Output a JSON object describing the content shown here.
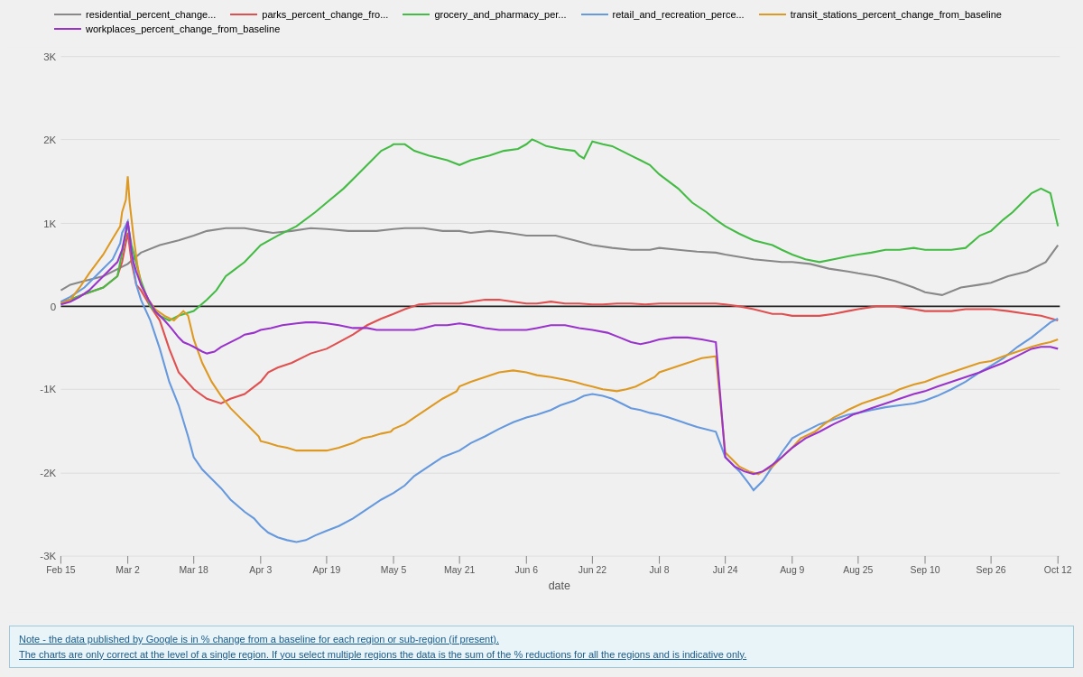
{
  "legend": {
    "items": [
      {
        "label": "residential_percent_change...",
        "color": "#888888"
      },
      {
        "label": "parks_percent_change_fro...",
        "color": "#e05050"
      },
      {
        "label": "grocery_and_pharmacy_per...",
        "color": "#44bb44"
      },
      {
        "label": "retail_and_recreation_perce...",
        "color": "#6699dd"
      },
      {
        "label": "transit_stations_percent_change_from_baseline",
        "color": "#dd9922"
      },
      {
        "label": "workplaces_percent_change_from_baseline",
        "color": "#9933cc"
      }
    ]
  },
  "xaxis": {
    "label": "date",
    "ticks": [
      "Feb 15",
      "Mar 2",
      "Mar 18",
      "Apr 3",
      "Apr 19",
      "May 5",
      "May 21",
      "Jun 6",
      "Jun 22",
      "Jul 8",
      "Jul 24",
      "Aug 9",
      "Aug 25",
      "Sep 10",
      "Sep 26",
      "Oct 12"
    ]
  },
  "yaxis": {
    "ticks": [
      "3K",
      "2K",
      "1K",
      "0",
      "-1K",
      "-2K",
      "-3K"
    ]
  },
  "note": {
    "line1": "Note - the data published by Google is in % change from a baseline for each region or sub-region (if present).",
    "line2": "The charts are only correct at the level of a single region. If you select multiple regions the data is the sum of the % reductions for all the regions and is indicative only."
  }
}
